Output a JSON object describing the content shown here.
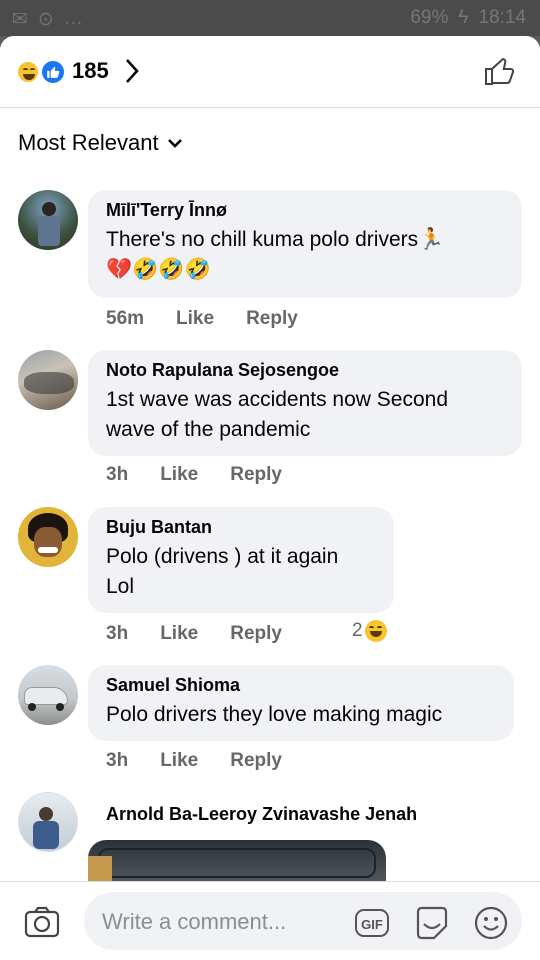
{
  "status_bar": {
    "battery": "69%",
    "time": "18:14"
  },
  "reactions": {
    "count": "185",
    "icons": [
      "laugh-emoji",
      "like-emoji"
    ]
  },
  "sort": {
    "label": "Most Relevant"
  },
  "comments": [
    {
      "author": "Mīlī'Terry Īnnø",
      "text": "There's no chill kuma polo drivers🏃",
      "emoji_line": "💔🤣🤣🤣",
      "time": "56m",
      "like": "Like",
      "reply": "Reply"
    },
    {
      "author": "Noto Rapulana Sejosengoe",
      "text_lines": [
        "1st wave was accidents now Second",
        "wave of the pandemic"
      ],
      "time": "3h",
      "like": "Like",
      "reply": "Reply"
    },
    {
      "author": "Buju Bantan",
      "text_lines": [
        "Polo (drivens ) at it again",
        "Lol"
      ],
      "time": "3h",
      "like": "Like",
      "reply": "Reply",
      "reaction_count": "2"
    },
    {
      "author": "Samuel Shioma",
      "text": "Polo drivers they love making magic",
      "time": "3h",
      "like": "Like",
      "reply": "Reply"
    },
    {
      "author": "Arnold Ba-Leeroy Zvinavashe Jenah"
    }
  ],
  "composer": {
    "placeholder": "Write a comment..."
  },
  "colors": {
    "accent": "#1877f2",
    "bubble": "#f0f2f5",
    "muted": "#65676b",
    "emoji": "#f7c32f"
  }
}
